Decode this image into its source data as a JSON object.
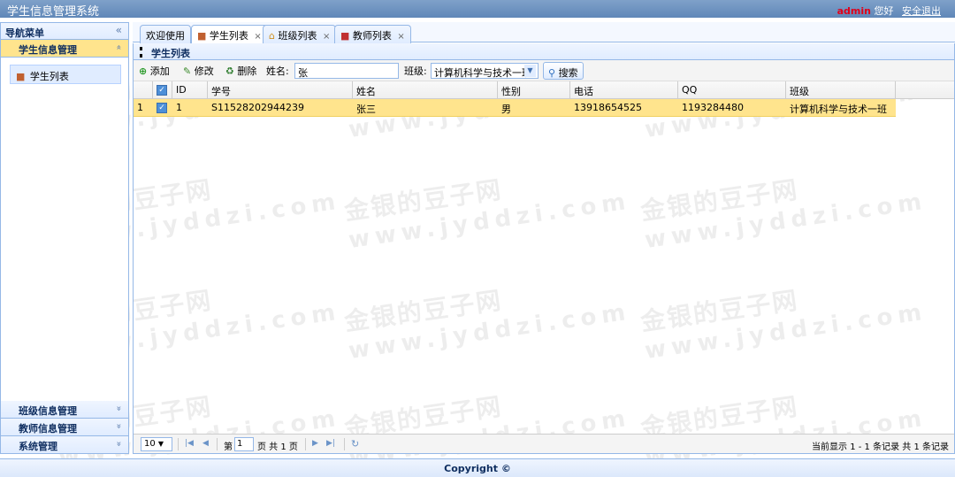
{
  "app": {
    "title": "学生信息管理系统",
    "user": "admin",
    "greeting": "您好",
    "logout": "安全退出"
  },
  "sidebar": {
    "header": "导航菜单",
    "collapse": "«",
    "sections": [
      {
        "label": "学生信息管理",
        "toggle": "«"
      },
      {
        "label": "班级信息管理",
        "toggle": "»"
      },
      {
        "label": "教师信息管理",
        "toggle": "»"
      },
      {
        "label": "系统管理",
        "toggle": "»"
      }
    ],
    "items": [
      {
        "label": "学生列表"
      }
    ]
  },
  "tabs": [
    {
      "label": "欢迎使用"
    },
    {
      "label": "学生列表",
      "close": "×"
    },
    {
      "label": "班级列表",
      "close": "×"
    },
    {
      "label": "教师列表",
      "close": "×"
    }
  ],
  "panel": {
    "title": "学生列表"
  },
  "toolbar": {
    "add": "添加",
    "edit": "修改",
    "delete": "删除",
    "name_label": "姓名:",
    "name_value": "张",
    "class_label": "班级:",
    "class_value": "计算机科学与技术一班",
    "search": "搜索"
  },
  "grid": {
    "columns": [
      "ID",
      "学号",
      "姓名",
      "性别",
      "电话",
      "QQ",
      "班级"
    ],
    "rows": [
      {
        "num": "1",
        "id": "1",
        "sno": "S11528202944239",
        "name": "张三",
        "gender": "男",
        "phone": "13918654525",
        "qq": "1193284480",
        "class": "计算机科学与技术一班"
      }
    ]
  },
  "pager": {
    "page_size": "10",
    "page_label": "第",
    "page": "1",
    "of_label": "页 共 1 页",
    "summary": "当前显示 1 - 1 条记录 共 1 条记录"
  },
  "footer": {
    "copyright": "Copyright ©"
  },
  "watermark": {
    "line1": "金银的豆子网",
    "line2": "www.jyddzi.com"
  }
}
